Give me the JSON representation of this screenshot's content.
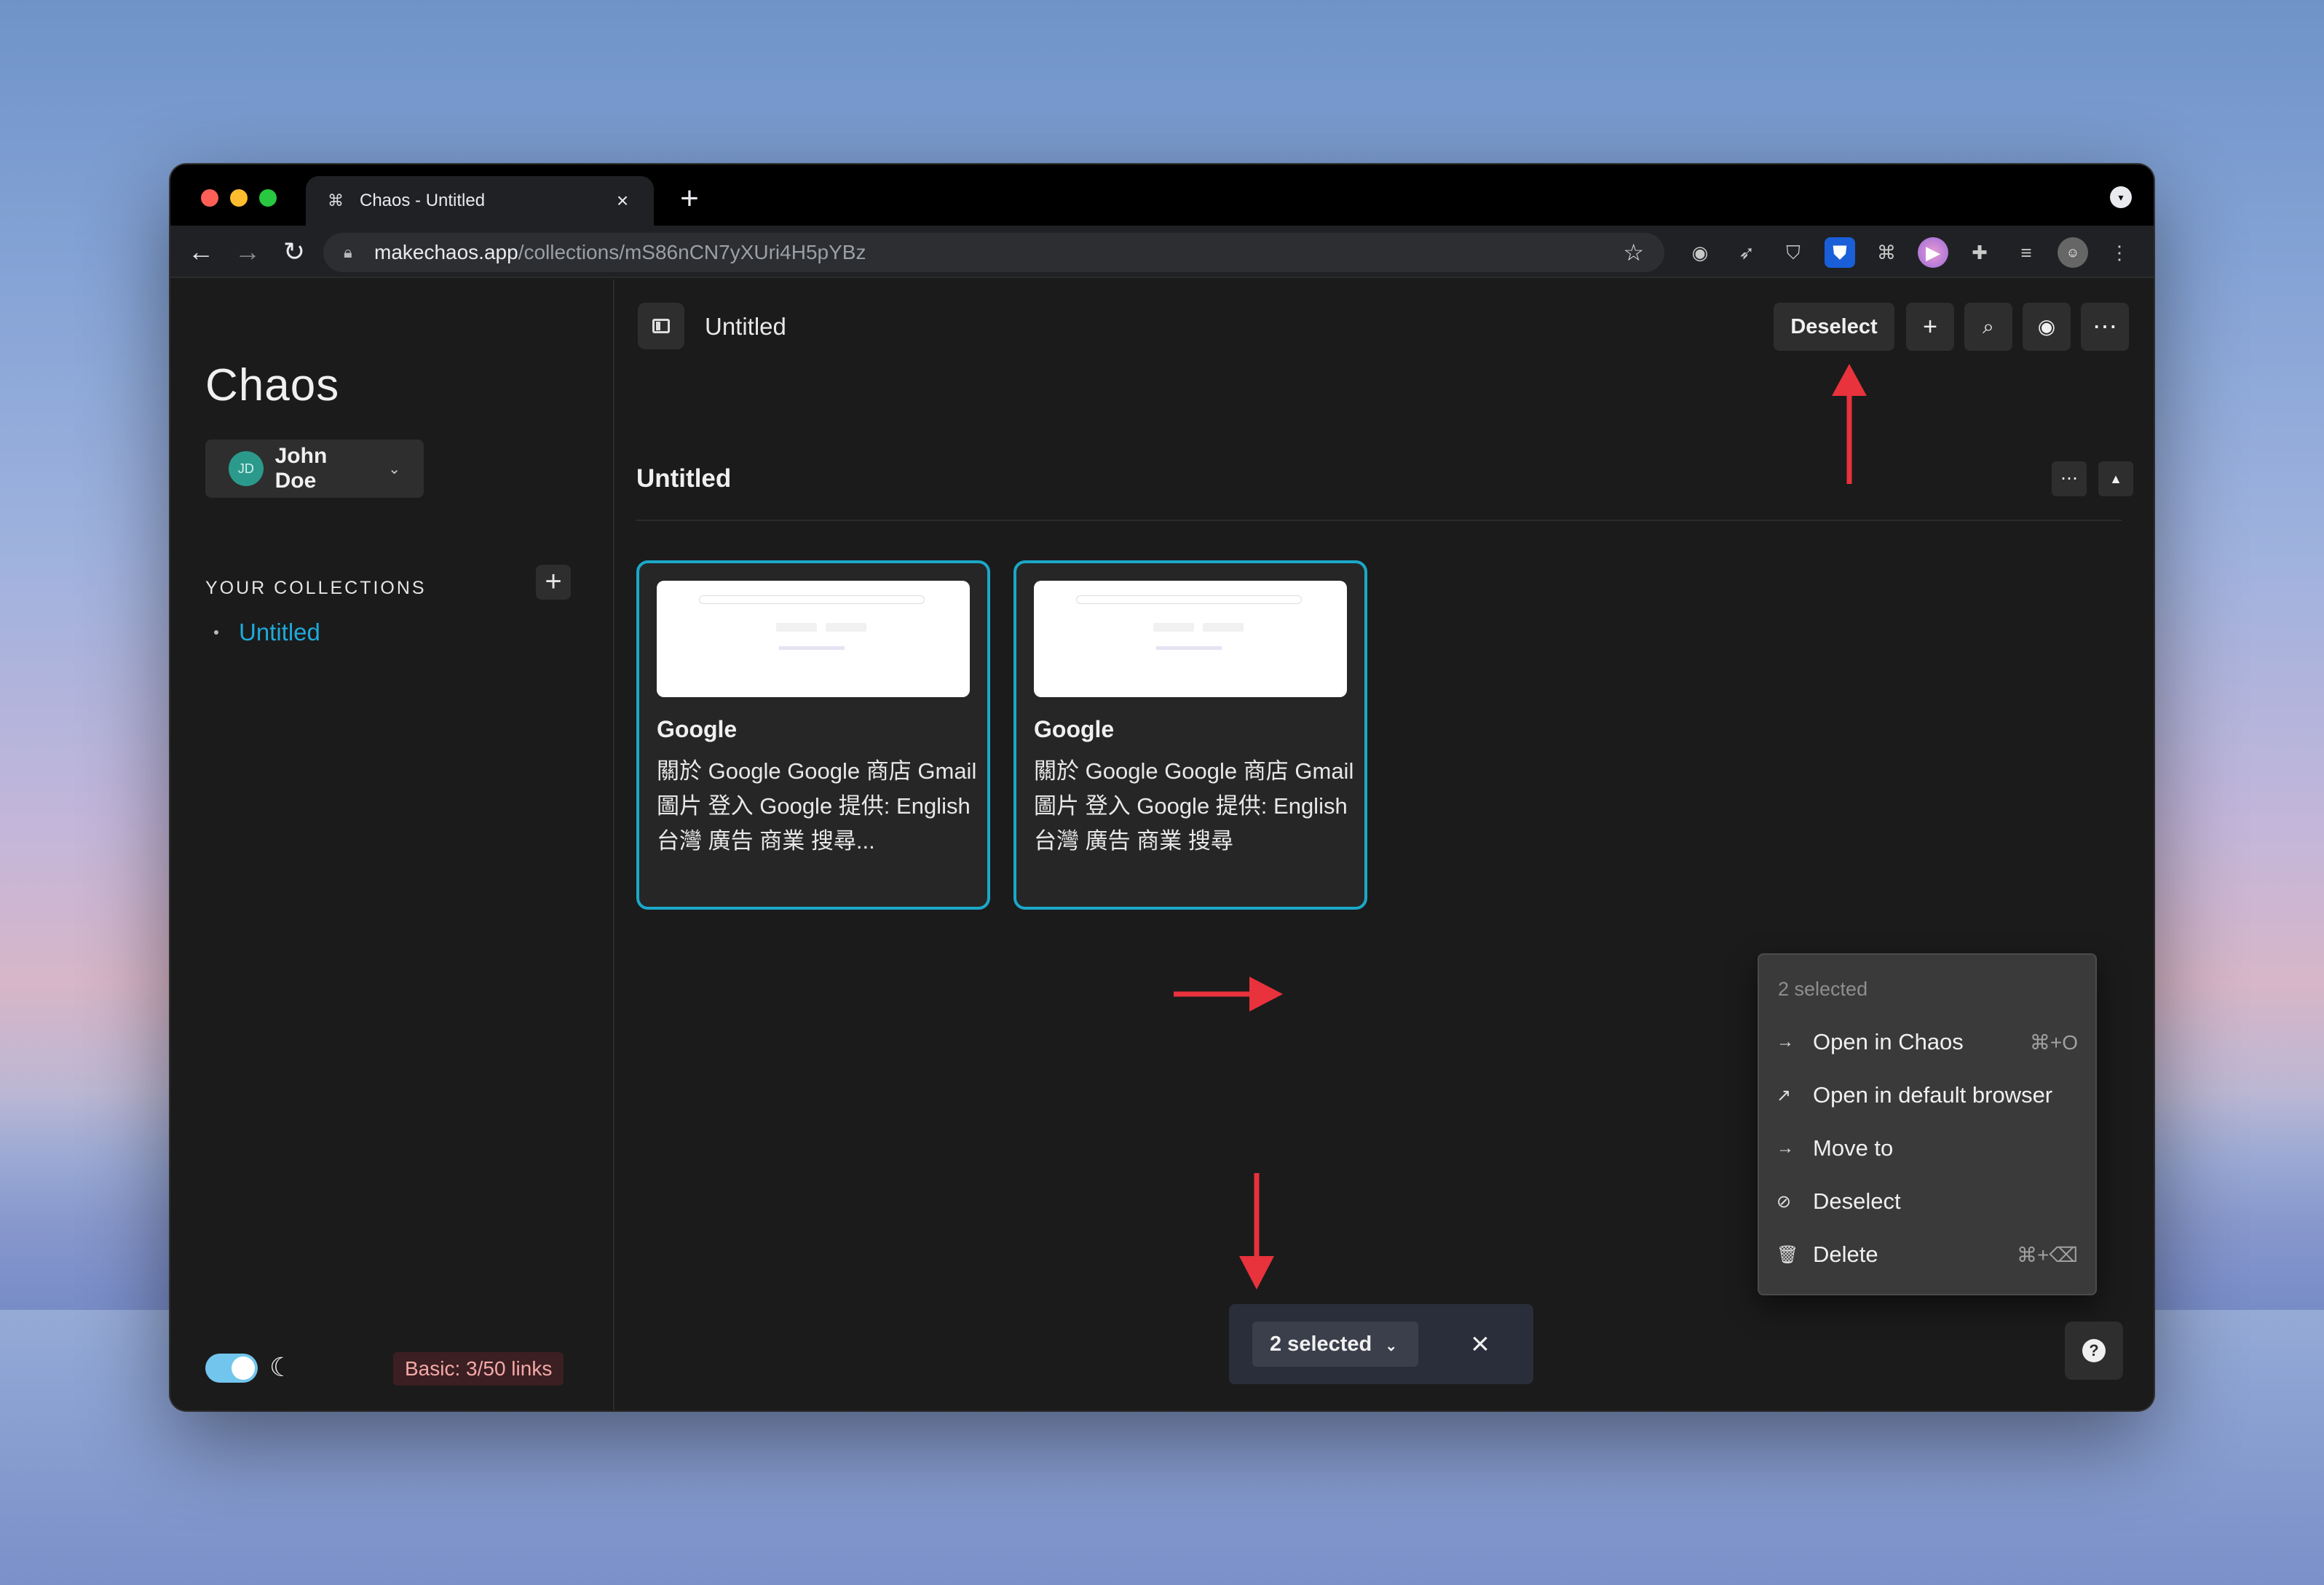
{
  "browser": {
    "tab_title": "Chaos - Untitled",
    "new_tab_label": "+",
    "url_host": "makechaos.app",
    "url_path": "/collections/mS86nCN7yXUri4H5pYBz"
  },
  "sidebar": {
    "brand": "Chaos",
    "user": {
      "initials": "JD",
      "name": "John Doe"
    },
    "collections_heading": "YOUR COLLECTIONS",
    "collections": [
      {
        "label": "Untitled"
      }
    ],
    "plan_badge": "Basic: 3/50 links"
  },
  "header": {
    "title": "Untitled",
    "deselect_label": "Deselect"
  },
  "section": {
    "title": "Untitled"
  },
  "cards": [
    {
      "title": "Google",
      "description": "關於 Google Google 商店 Gmail圖片 登入 Google 提供: English 台灣 廣告 商業 搜尋..."
    },
    {
      "title": "Google",
      "description": "關於 Google Google 商店 Gmail圖片 登入 Google 提供: English 台灣 廣告 商業 搜尋"
    }
  ],
  "context_menu": {
    "heading": "2 selected",
    "items": [
      {
        "icon": "arrow-right-icon",
        "label": "Open in Chaos",
        "shortcut": "⌘+O"
      },
      {
        "icon": "external-link-icon",
        "label": "Open in default browser",
        "shortcut": ""
      },
      {
        "icon": "arrow-right-icon",
        "label": "Move to",
        "shortcut": ""
      },
      {
        "icon": "ban-icon",
        "label": "Deselect",
        "shortcut": ""
      },
      {
        "icon": "trash-icon",
        "label": "Delete",
        "shortcut": "⌘+⌫"
      }
    ]
  },
  "selection_bar": {
    "label": "2 selected"
  },
  "colors": {
    "accent": "#1fa9d9",
    "card_border": "#1aa8c9",
    "annotation_arrow": "#e8323c"
  }
}
